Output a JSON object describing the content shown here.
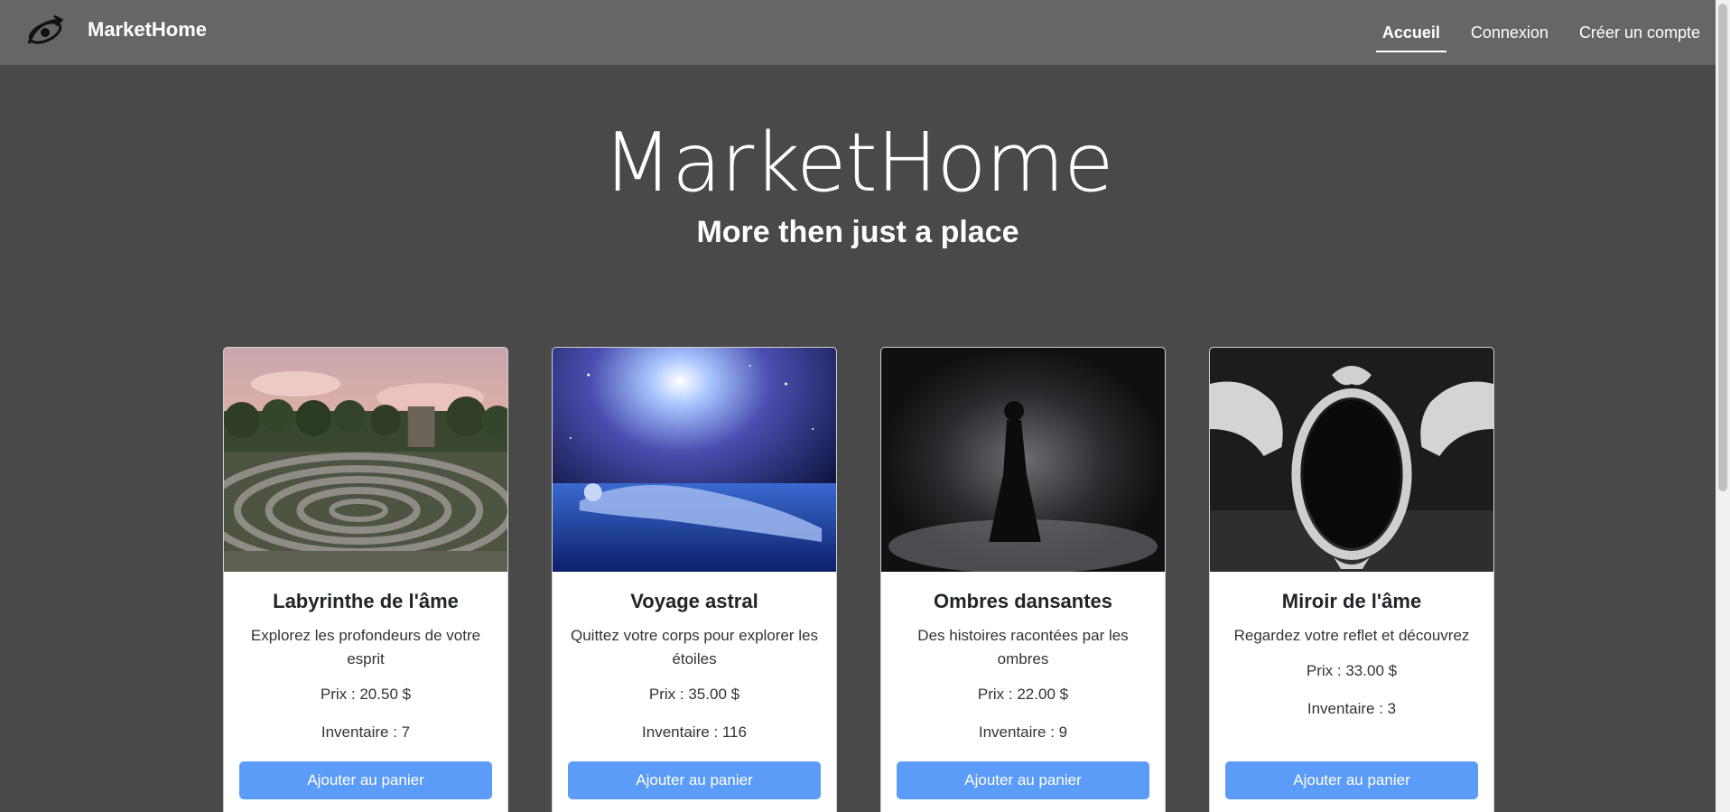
{
  "navbar": {
    "brand": "MarketHome",
    "links": [
      {
        "label": "Accueil",
        "active": true
      },
      {
        "label": "Connexion",
        "active": false
      },
      {
        "label": "Créer un compte",
        "active": false
      }
    ]
  },
  "hero": {
    "title": "MarketHome",
    "subtitle": "More then just a place"
  },
  "products": [
    {
      "title": "Labyrinthe de l'âme",
      "description": "Explorez les profondeurs de votre esprit",
      "price": "Prix : 20.50 $",
      "stock": "Inventaire : 7",
      "button": "Ajouter au panier"
    },
    {
      "title": "Voyage astral",
      "description": "Quittez votre corps pour explorer les étoiles",
      "price": "Prix : 35.00 $",
      "stock": "Inventaire : 116",
      "button": "Ajouter au panier"
    },
    {
      "title": "Ombres dansantes",
      "description": "Des histoires racontées par les ombres",
      "price": "Prix : 22.00 $",
      "stock": "Inventaire : 9",
      "button": "Ajouter au panier"
    },
    {
      "title": "Miroir de l'âme",
      "description": "Regardez votre reflet et découvrez",
      "price": "Prix : 33.00 $",
      "stock": "Inventaire : 3",
      "button": "Ajouter au panier"
    }
  ],
  "colors": {
    "background": "#494949",
    "navbar": "#666666",
    "button": "#5b9cf8"
  }
}
